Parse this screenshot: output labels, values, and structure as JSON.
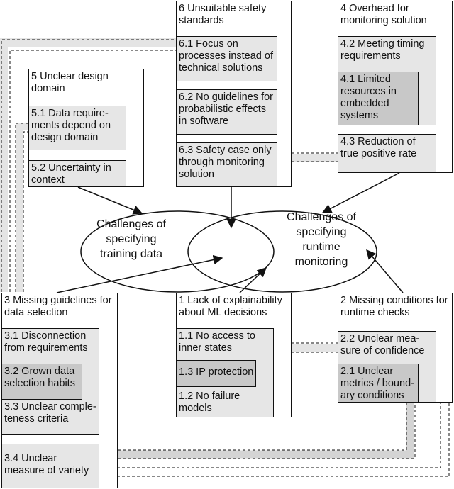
{
  "diagram": {
    "center": {
      "left_ellipse": "Challenges of\nspecifying\ntraining data",
      "right_ellipse": "Challenges of\nspecifying\nruntime\nmonitoring"
    },
    "groups": {
      "g5": {
        "title": "5 Unclear design\ndomain",
        "items": [
          "5.1 Data require-\nments depend on\ndesign domain",
          "5.2 Uncertainty in\ncontext"
        ]
      },
      "g6": {
        "title": "6 Unsuitable safety\nstandards",
        "items": [
          "6.1 Focus on\nprocesses instead of\ntechnical solutions",
          "6.2 No guidelines for\nprobabilistic effects\nin software",
          "6.3 Safety case only\nthrough monitoring\nsolution"
        ]
      },
      "g4": {
        "title": "4 Overhead for\nmonitoring solution",
        "items": [
          "4.2 Meeting timing\nrequirements",
          "4.1 Limited\nresources in\nembedded\nsystems",
          "4.3 Reduction of\ntrue positive rate"
        ]
      },
      "g3": {
        "title": "3 Missing guidelines for\ndata selection",
        "items": [
          "3.1 Disconnection\nfrom requirements",
          "3.2 Grown data\nselection habits",
          "3.3 Unclear comple-\nteness criteria",
          "3.4 Unclear\nmeasure of variety"
        ]
      },
      "g1": {
        "title": "1 Lack of explainability\nabout ML decisions",
        "items": [
          "1.1 No access to\ninner states",
          "1.3 IP protection",
          "1.2 No failure\nmodels"
        ]
      },
      "g2": {
        "title": "2 Missing conditions for\nruntime checks",
        "items": [
          "2.2 Unclear mea-\nsure of confidence",
          "2.1 Unclear\nmetrics / bound-\nary conditions"
        ]
      }
    },
    "colors": {
      "sub_fill": "#e6e6e6",
      "nested_fill": "#c8c8c8",
      "connector_band": "#e2e2e2",
      "line": "#111111"
    }
  }
}
